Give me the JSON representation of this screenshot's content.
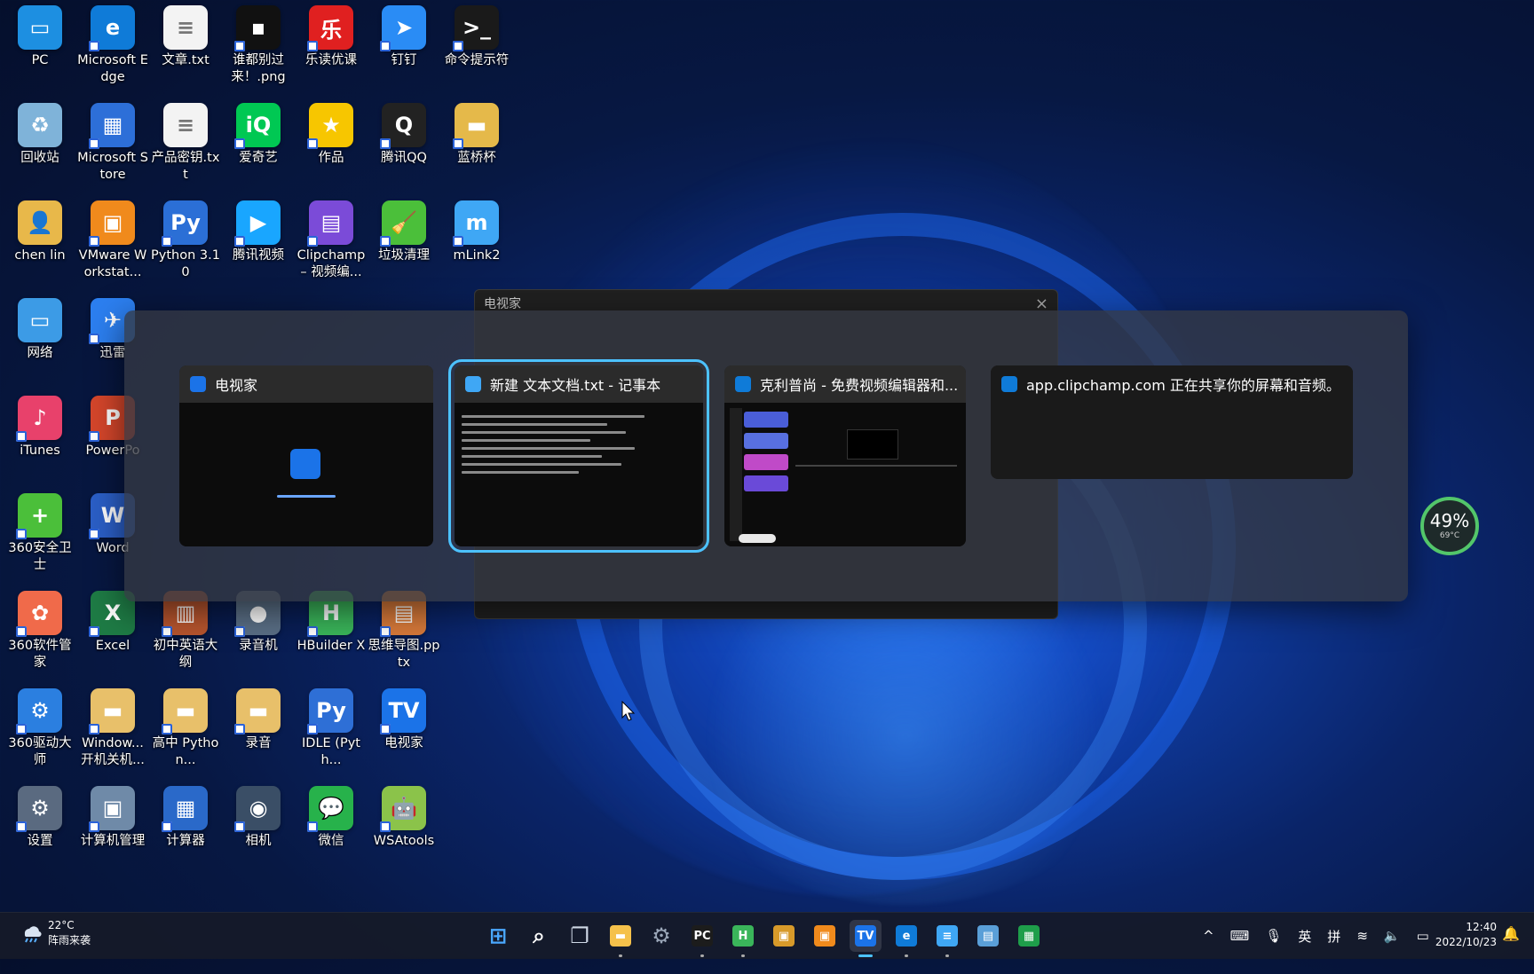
{
  "desktop_icons": [
    {
      "label": "PC",
      "color": "#1d8fe1",
      "glyph": "▭"
    },
    {
      "label": "Microsoft Edge",
      "color": "#0f7bd8",
      "glyph": "e"
    },
    {
      "label": "文章.txt",
      "color": "#f3f3f3",
      "glyph": "≡"
    },
    {
      "label": "谁都别过来！.png",
      "color": "#111111",
      "glyph": "▪"
    },
    {
      "label": "乐读优课",
      "color": "#e02020",
      "glyph": "乐"
    },
    {
      "label": "钉钉",
      "color": "#2a8cf5",
      "glyph": "➤"
    },
    {
      "label": "命令提示符",
      "color": "#1a1a1a",
      "glyph": ">_"
    },
    {
      "label": "回收站",
      "color": "#7fb3d9",
      "glyph": "♻"
    },
    {
      "label": "Microsoft Store",
      "color": "#2d6fd8",
      "glyph": "▦"
    },
    {
      "label": "产品密钥.txt",
      "color": "#f3f3f3",
      "glyph": "≡"
    },
    {
      "label": "爱奇艺",
      "color": "#00c853",
      "glyph": "iQ"
    },
    {
      "label": "作品",
      "color": "#f7c600",
      "glyph": "★"
    },
    {
      "label": "腾讯QQ",
      "color": "#222222",
      "glyph": "Q"
    },
    {
      "label": "蓝桥杯",
      "color": "#e5b94a",
      "glyph": "▬"
    },
    {
      "label": "chen lin",
      "color": "#e8b84a",
      "glyph": "👤"
    },
    {
      "label": "VMware Workstat...",
      "color": "#f08a1c",
      "glyph": "▣"
    },
    {
      "label": "Python 3.10",
      "color": "#2b6fd6",
      "glyph": "Py"
    },
    {
      "label": "腾讯视频",
      "color": "#19a6ff",
      "glyph": "▶"
    },
    {
      "label": "Clipchamp – 视频编...",
      "color": "#7b4bd8",
      "glyph": "▤"
    },
    {
      "label": "垃圾清理",
      "color": "#4bbf3a",
      "glyph": "🧹"
    },
    {
      "label": "mLink2",
      "color": "#3fa7f5",
      "glyph": "m"
    },
    {
      "label": "网络",
      "color": "#3c9be6",
      "glyph": "▭"
    },
    {
      "label": "迅雷",
      "color": "#2c7ff0",
      "glyph": "✈"
    },
    {
      "label": "iTunes",
      "color": "#e8416b",
      "glyph": "♪"
    },
    {
      "label": "PowerPo",
      "color": "#d5462b",
      "glyph": "P"
    },
    {
      "label": "360安全卫士",
      "color": "#4bbf3a",
      "glyph": "+"
    },
    {
      "label": "Word",
      "color": "#2b5fc7",
      "glyph": "W"
    },
    {
      "label": "360软件管家",
      "color": "#f06a4a",
      "glyph": "✿"
    },
    {
      "label": "Excel",
      "color": "#1e7b45",
      "glyph": "X"
    },
    {
      "label": "初中英语大纲",
      "color": "#b8552e",
      "glyph": "▥"
    },
    {
      "label": "录音机",
      "color": "#5a6f86",
      "glyph": "●"
    },
    {
      "label": "HBuilder X",
      "color": "#3ab55a",
      "glyph": "H"
    },
    {
      "label": "思维导图.pptx",
      "color": "#d87a3a",
      "glyph": "▤"
    },
    {
      "label": "360驱动大师",
      "color": "#2b7fe0",
      "glyph": "⚙"
    },
    {
      "label": "Window... 开机关机...",
      "color": "#e8c06a",
      "glyph": "▬"
    },
    {
      "label": "高中 Python...",
      "color": "#e8c06a",
      "glyph": "▬"
    },
    {
      "label": "录音",
      "color": "#e8c06a",
      "glyph": "▬"
    },
    {
      "label": "IDLE (Pyth...",
      "color": "#2e6fd6",
      "glyph": "Py"
    },
    {
      "label": "电视家",
      "color": "#1b73e8",
      "glyph": "TV"
    },
    {
      "label": "设置",
      "color": "#5a6a80",
      "glyph": "⚙"
    },
    {
      "label": "计算机管理",
      "color": "#6f8aa8",
      "glyph": "▣"
    },
    {
      "label": "计算器",
      "color": "#2a69c9",
      "glyph": "▦"
    },
    {
      "label": "相机",
      "color": "#3a4e66",
      "glyph": "◉"
    },
    {
      "label": "微信",
      "color": "#27b24b",
      "glyph": "💬"
    },
    {
      "label": "WSAtools",
      "color": "#8bc34a",
      "glyph": "🤖"
    }
  ],
  "background_window": {
    "title": "电视家",
    "close": "×"
  },
  "switcher": {
    "cards": [
      {
        "title": "电视家",
        "color": "#1b73e8"
      },
      {
        "title": "新建 文本文档.txt - 记事本",
        "color": "#3fa7f5"
      },
      {
        "title": "克利普尚 - 免费视频编辑器和...",
        "color": "#0f7bd8"
      },
      {
        "title": "app.clipchamp.com 正在共享你的屏幕和音频。",
        "color": "#0f7bd8"
      }
    ]
  },
  "performance": {
    "percent": "49%",
    "temp": "69°C",
    "ring_color": "#53c66a"
  },
  "taskbar": {
    "weather": {
      "temp": "22°C",
      "desc": "阵雨来袭"
    },
    "apps": [
      {
        "name": "start",
        "glyph": "⊞",
        "color": "#4aa8ff"
      },
      {
        "name": "search",
        "glyph": "⌕",
        "color": "#ffffff"
      },
      {
        "name": "task-view",
        "glyph": "❐",
        "color": "#cfd8e6"
      },
      {
        "name": "file-explorer",
        "glyph": "▬",
        "color": "#f5c14b"
      },
      {
        "name": "settings",
        "glyph": "⚙",
        "color": "#9aa6b8"
      },
      {
        "name": "pycharm",
        "glyph": "PC",
        "color": "#1c1c1c"
      },
      {
        "name": "hbuilder",
        "glyph": "H",
        "color": "#3ab55a"
      },
      {
        "name": "app-orange",
        "glyph": "▣",
        "color": "#d79a2a"
      },
      {
        "name": "vmware",
        "glyph": "▣",
        "color": "#f08a1c"
      },
      {
        "name": "dianshijia",
        "glyph": "TV",
        "color": "#1b73e8"
      },
      {
        "name": "edge",
        "glyph": "e",
        "color": "#0f7bd8"
      },
      {
        "name": "notepad",
        "glyph": "≡",
        "color": "#3fa7f5"
      },
      {
        "name": "photos",
        "glyph": "▤",
        "color": "#5a9fd8"
      },
      {
        "name": "excel-green",
        "glyph": "▦",
        "color": "#1e9e4a"
      }
    ],
    "tray": {
      "chevron": "^",
      "keyboard": "⌨",
      "mic": "🎙",
      "lang": "英",
      "ime": "拼",
      "wifi": "≋",
      "volume": "🔈",
      "battery": "▭"
    },
    "time": "12:40",
    "date": "2022/10/23",
    "notification": "🔔"
  }
}
